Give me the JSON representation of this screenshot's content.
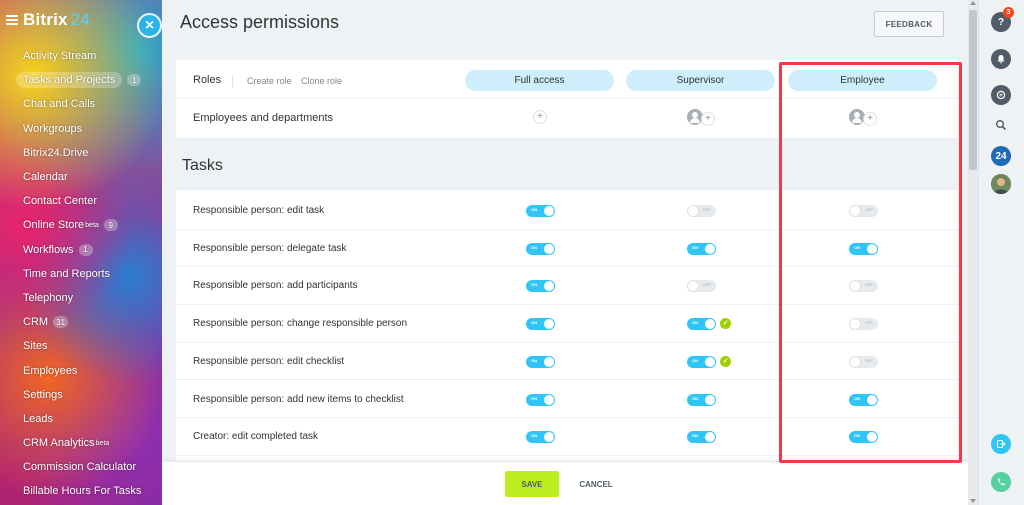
{
  "sidebar": {
    "logo_main": "Bitrix",
    "logo_num": "24",
    "items": [
      {
        "label": "Activity Stream",
        "badge": ""
      },
      {
        "label": "Tasks and Projects",
        "badge": "1",
        "active": true
      },
      {
        "label": "Chat and Calls",
        "badge": ""
      },
      {
        "label": "Workgroups",
        "badge": ""
      },
      {
        "label": "Bitrix24.Drive",
        "badge": ""
      },
      {
        "label": "Calendar",
        "badge": ""
      },
      {
        "label": "Contact Center",
        "badge": ""
      },
      {
        "label": "Online Store",
        "sup": "beta",
        "badge": "9"
      },
      {
        "label": "Workflows",
        "badge": "1"
      },
      {
        "label": "Time and Reports",
        "badge": ""
      },
      {
        "label": "Telephony",
        "badge": ""
      },
      {
        "label": "CRM",
        "badge": "31"
      },
      {
        "label": "Sites",
        "badge": ""
      },
      {
        "label": "Employees",
        "badge": ""
      },
      {
        "label": "Settings",
        "badge": ""
      },
      {
        "label": "Leads",
        "badge": ""
      },
      {
        "label": "CRM Analytics",
        "sup": "beta",
        "badge": ""
      },
      {
        "label": "Commission Calculator",
        "badge": ""
      },
      {
        "label": "Billable Hours For Tasks",
        "badge": ""
      }
    ]
  },
  "close_glyph": "×",
  "header": {
    "title": "Access permissions",
    "feedback_label": "FEEDBACK"
  },
  "roles_row": {
    "label": "Roles",
    "create_role": "Create role",
    "clone_role": "Clone role"
  },
  "roles": [
    {
      "name": "Full access"
    },
    {
      "name": "Supervisor"
    },
    {
      "name": "Employee"
    }
  ],
  "employees_row": {
    "label": "Employees and departments",
    "plus": "+"
  },
  "section": {
    "title": "Tasks"
  },
  "toggle_text": {
    "on": "ON",
    "off": "OFF"
  },
  "check_glyph": "✓",
  "permissions": [
    {
      "label": "Responsible person: edit task",
      "values": [
        true,
        false,
        false
      ],
      "checks": [
        false,
        false,
        false
      ]
    },
    {
      "label": "Responsible person: delegate task",
      "values": [
        true,
        true,
        true
      ],
      "checks": [
        false,
        false,
        false
      ]
    },
    {
      "label": "Responsible person: add participants",
      "values": [
        true,
        false,
        false
      ],
      "checks": [
        false,
        false,
        false
      ]
    },
    {
      "label": "Responsible person: change responsible person",
      "values": [
        true,
        true,
        false
      ],
      "checks": [
        false,
        true,
        false
      ]
    },
    {
      "label": "Responsible person: edit checklist",
      "values": [
        true,
        true,
        false
      ],
      "checks": [
        false,
        true,
        false
      ]
    },
    {
      "label": "Responsible person: add new items to checklist",
      "values": [
        true,
        true,
        true
      ],
      "checks": [
        false,
        false,
        false
      ]
    },
    {
      "label": "Creator: edit completed task",
      "values": [
        true,
        true,
        true
      ],
      "checks": [
        false,
        false,
        false
      ]
    }
  ],
  "footer": {
    "save_label": "SAVE",
    "cancel_label": "CANCEL"
  },
  "rail": {
    "help_badge": "3",
    "bitrix_label": "24"
  },
  "colors": {
    "accent": "#2fc6f6",
    "save": "#bbed21",
    "highlight": "#ef3b45",
    "check": "#9dcf00"
  }
}
